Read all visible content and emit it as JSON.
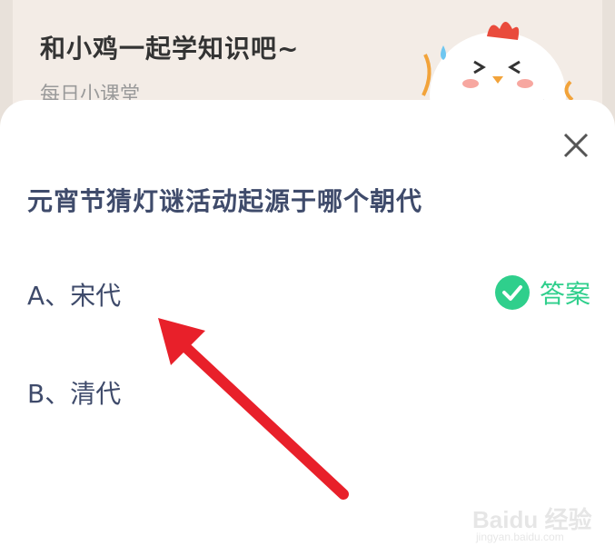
{
  "header": {
    "title": "和小鸡一起学知识吧~",
    "subtitle": "每日小课堂",
    "mascot_icon": "chicken-mascot-icon"
  },
  "quiz": {
    "question": "元宵节猜灯谜活动起源于哪个朝代",
    "options": [
      {
        "label": "A、宋代",
        "is_answer": true
      },
      {
        "label": "B、清代",
        "is_answer": false
      }
    ],
    "answer_label": "答案",
    "close_icon": "close-icon",
    "check_icon": "check-circle-icon"
  },
  "annotation": {
    "arrow_icon": "red-arrow-icon",
    "arrow_color": "#e8202a"
  },
  "watermark": {
    "main": "Baidu 经验",
    "sub": "jingyan.baidu.com"
  },
  "colors": {
    "accent_green": "#2fcf8c",
    "text_navy": "#3f4b6b"
  }
}
